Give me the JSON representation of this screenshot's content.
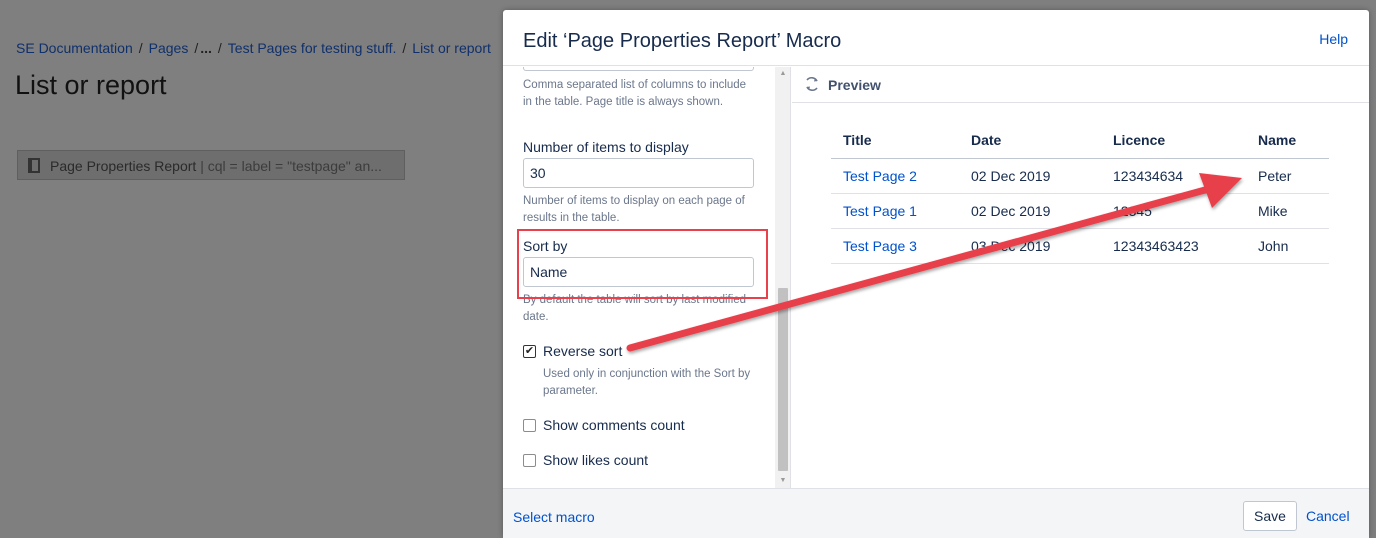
{
  "background": {
    "breadcrumb": [
      "SE Documentation",
      "Pages",
      "...",
      "Test Pages for testing stuff.",
      "List or report"
    ],
    "page_title": "List or report",
    "macro_placeholder": {
      "name": "Page Properties Report",
      "params": " | cql = label = \"testpage\" an..."
    }
  },
  "dialog": {
    "title": "Edit ‘Page Properties Report’ Macro",
    "help_label": "Help",
    "form": {
      "columns_help": "Comma separated list of columns to include in the table. Page title is always shown.",
      "items_label": "Number of items to display",
      "items_value": "30",
      "items_help": "Number of items to display on each page of results in the table.",
      "sort_label": "Sort by",
      "sort_value": "Name",
      "sort_help": "By default the table will sort by last modified date.",
      "reverse_sort_label": "Reverse sort",
      "reverse_sort_checked": true,
      "reverse_sort_help": "Used only in conjunction with the Sort by parameter.",
      "comments_label": "Show comments count",
      "likes_label": "Show likes count"
    },
    "preview": {
      "label": "Preview",
      "columns": [
        "Title",
        "Date",
        "Licence",
        "Name"
      ],
      "rows": [
        {
          "title": "Test Page 2",
          "date": "02 Dec 2019",
          "licence": "123434634",
          "name": "Peter"
        },
        {
          "title": "Test Page 1",
          "date": "02 Dec 2019",
          "licence": "12345",
          "name": "Mike"
        },
        {
          "title": "Test Page 3",
          "date": "03 Dec 2019",
          "licence": "12343463423",
          "name": "John"
        }
      ]
    },
    "footer": {
      "select_macro": "Select macro",
      "save": "Save",
      "cancel": "Cancel"
    }
  },
  "colors": {
    "link": "#0052cc",
    "annotation_red": "#e8414b",
    "overlay": "#7f7f7f"
  }
}
